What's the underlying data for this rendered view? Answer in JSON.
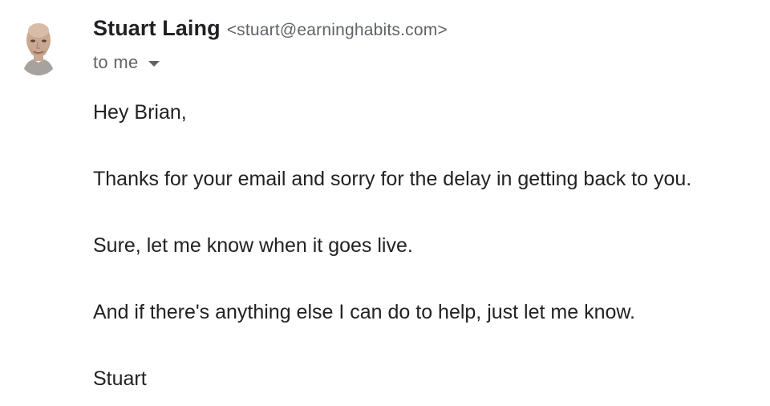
{
  "sender": {
    "name": "Stuart Laing",
    "email": "<stuart@earninghabits.com>"
  },
  "recipient": {
    "label": "to me"
  },
  "message": {
    "paragraphs": [
      "Hey Brian,",
      "Thanks for your email and sorry for the delay in getting back to you.",
      "Sure, let me know when it goes live.",
      "And if there's anything else I can do to help, just let me know.",
      "Stuart"
    ]
  },
  "colors": {
    "name_text": "#202124",
    "secondary_text": "#5f6368",
    "body_text": "#222222",
    "background": "#ffffff"
  },
  "icons": {
    "avatar": "sender-avatar-photo",
    "details_toggle": "chevron-down-icon"
  }
}
